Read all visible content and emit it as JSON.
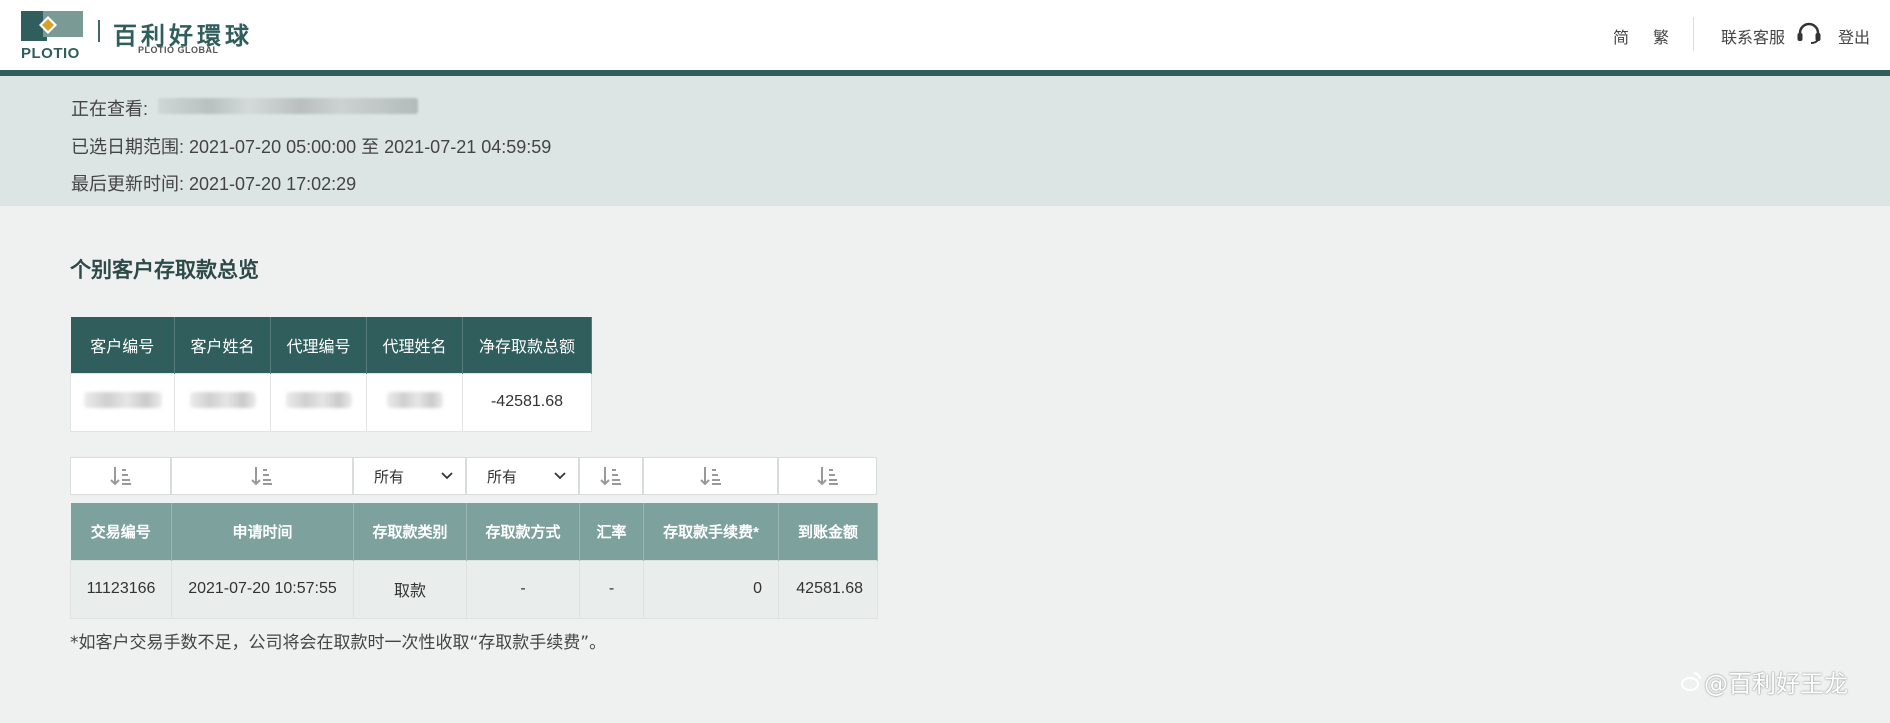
{
  "header": {
    "brand_cn": "百利好環球",
    "brand_en": "PLOTIO GLOBAL",
    "logo_text": "PLOTIO",
    "lang_simplified": "简",
    "lang_traditional": "繁",
    "contact": "联系客服",
    "logout": "登出"
  },
  "info": {
    "viewing_label": "正在查看:",
    "date_range": "已选日期范围: 2021-07-20 05:00:00 至 2021-07-21 04:59:59",
    "last_updated": "最后更新时间: 2021-07-20 17:02:29"
  },
  "section_title": "个别客户存取款总览",
  "summary": {
    "headers": [
      "客户编号",
      "客户姓名",
      "代理编号",
      "代理姓名",
      "净存取款总额"
    ],
    "net_total": "-42581.68"
  },
  "filters": {
    "type_select": "所有",
    "method_select": "所有"
  },
  "transactions": {
    "headers": [
      "交易编号",
      "申请时间",
      "存取款类别",
      "存取款方式",
      "汇率",
      "存取款手续费*",
      "到账金额"
    ],
    "rows": [
      [
        "11123166",
        "2021-07-20 10:57:55",
        "取款",
        "-",
        "-",
        "0",
        "42581.68"
      ]
    ]
  },
  "note": "*如客户交易手数不足，公司将会在取款时一次性收取“存取款手续费”。",
  "watermark": "@百利好王龙",
  "colors": {
    "primary": "#2f5e5c",
    "secondary_header": "#7da19c",
    "info_bg": "#dce5e4",
    "page_bg": "#eff1f1"
  },
  "icons": [
    "plotio-logo-icon",
    "headset-icon",
    "sort-icon",
    "chevron-down-icon",
    "weibo-icon"
  ]
}
